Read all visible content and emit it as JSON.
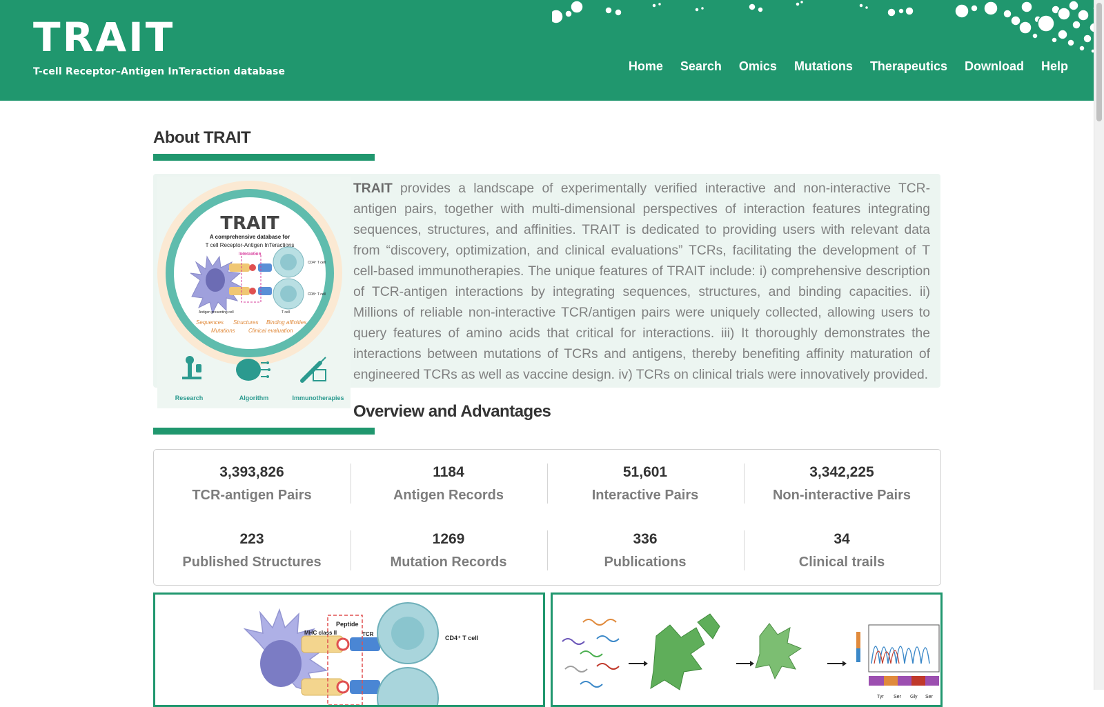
{
  "header": {
    "logo_title": "TRAIT",
    "logo_subtitle": "T-cell Receptor–Antigen InTeraction database",
    "nav": [
      "Home",
      "Search",
      "Omics",
      "Mutations",
      "Therapeutics",
      "Download",
      "Help"
    ]
  },
  "about": {
    "title": "About TRAIT",
    "lead": "TRAIT",
    "text": " provides a landscape of experimentally verified interactive and non-interactive TCR-antigen pairs, together with multi-dimensional perspectives of interaction features integrating sequences, structures, and affinities. TRAIT is dedicated to providing users with relevant data from “discovery, optimization, and clinical evaluations” TCRs, facilitating the development of T cell-based immunotherapies. The unique features of TRAIT include: i) comprehensive description of TCR-antigen interactions by integrating sequences, structures, and binding capacities. ii) Millions of reliable non-interactive TCR/antigen pairs were uniquely collected, allowing users to query features of amino acids that critical for interactions. iii) It thoroughly demonstrates the interactions between mutations of TCRs and antigens, thereby benefiting affinity maturation of engineered TCRs as well as vaccine design. iv) TCRs on clinical trials were innovatively provided.",
    "figure": {
      "title": "TRAIT",
      "subtitle1": "A comprehensive database for",
      "subtitle2": "T cell Receptor-Antigen InTeractions",
      "interaction": "Interaction",
      "cd4": "CD4⁺ T cell",
      "cd8": "CD8⁺ T cell",
      "apc": "Antigen presenting cell",
      "tcell": "T cell",
      "features": [
        "Sequences",
        "Structures",
        "Binding affinities",
        "Mutations",
        "Clinical evaluation"
      ],
      "icons": [
        "Research",
        "Algorithm",
        "Immunotherapies"
      ]
    }
  },
  "overview": {
    "title": "Overview and Advantages",
    "stats": [
      {
        "value": "3,393,826",
        "label": "TCR-antigen Pairs"
      },
      {
        "value": "1184",
        "label": "Antigen Records"
      },
      {
        "value": "51,601",
        "label": "Interactive Pairs"
      },
      {
        "value": "3,342,225",
        "label": "Non-interactive Pairs"
      },
      {
        "value": "223",
        "label": "Published Structures"
      },
      {
        "value": "1269",
        "label": "Mutation Records"
      },
      {
        "value": "336",
        "label": "Publications"
      },
      {
        "value": "34",
        "label": "Clinical trails"
      }
    ]
  },
  "cards": {
    "left": {
      "peptide": "Peptide",
      "mhc": "MHC class II",
      "tcr": "TCR",
      "cd4": "CD4⁺ T cell"
    },
    "right": {
      "tyr": "Tyr",
      "ser": "Ser",
      "gly": "Gly",
      "ser2": "Ser"
    }
  },
  "colors": {
    "brand": "#20976e",
    "text": "#333333",
    "muted": "#808080"
  }
}
